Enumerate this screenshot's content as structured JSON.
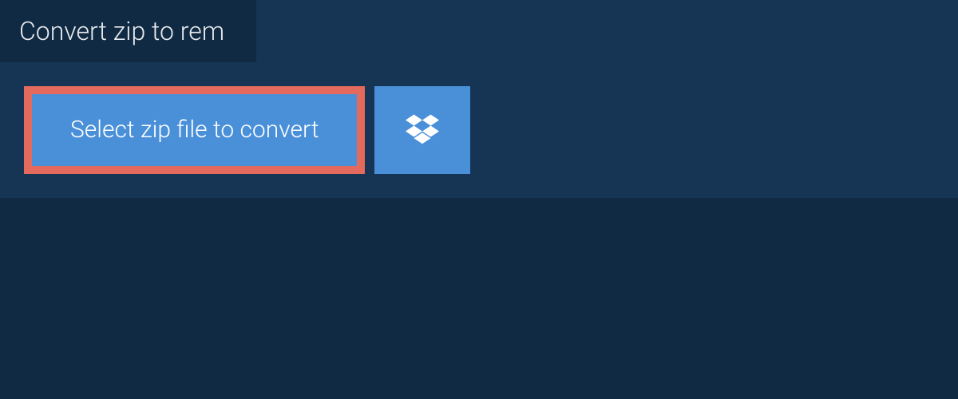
{
  "header": {
    "title": "Convert zip to rem"
  },
  "actions": {
    "select_label": "Select zip file to convert",
    "cloud_icon": "dropbox-icon"
  },
  "colors": {
    "page_bg": "#102a43",
    "panel_bg": "#163453",
    "button_bg": "#4a90d9",
    "highlight_border": "#e36a5c",
    "text_light": "#ffffff"
  }
}
